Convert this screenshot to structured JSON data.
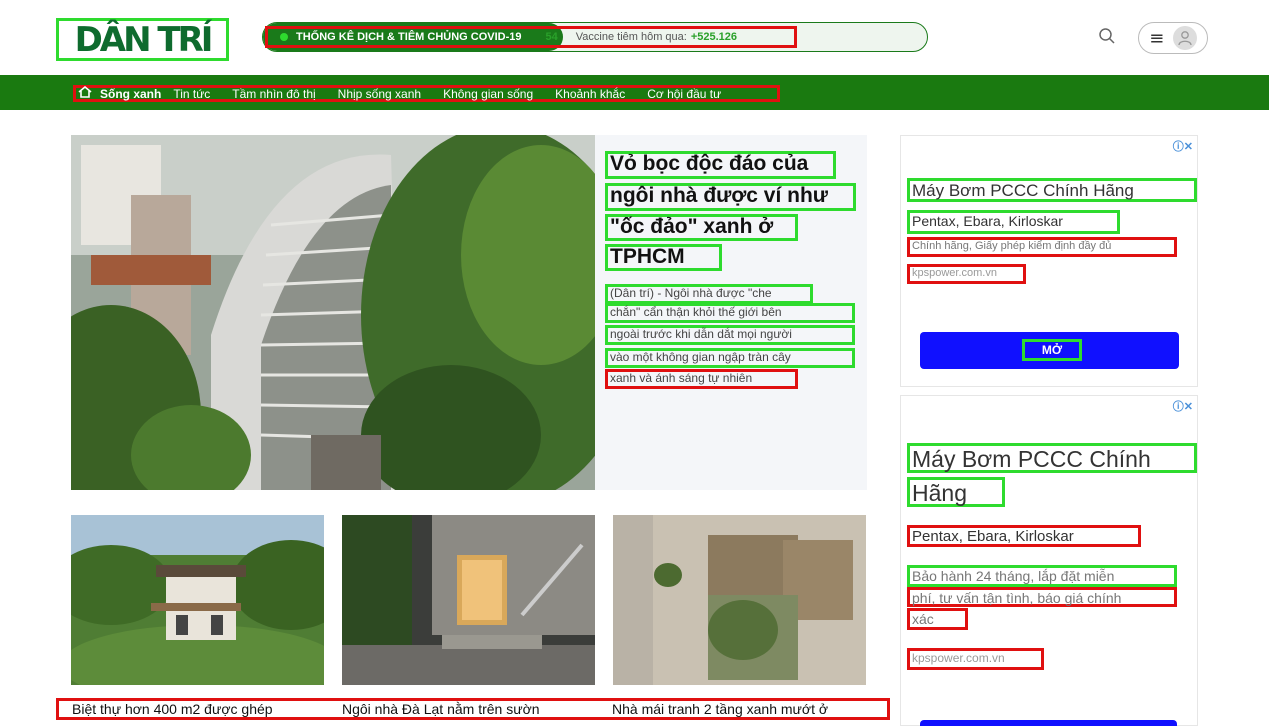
{
  "header": {
    "logo_text": "DÂN TRÍ",
    "covid_title": "THỐNG KÊ DỊCH & TIÊM CHỦNG COVID-19",
    "covid_count": "54",
    "vaccine_label": "Vaccine tiêm hôm qua:",
    "vaccine_count": "+525.126"
  },
  "nav": {
    "items": [
      "Sống xanh",
      "Tin tức",
      "Tầm nhìn đô thị",
      "Nhịp sống xanh",
      "Không gian sống",
      "Khoảnh khắc",
      "Cơ hội đầu tư"
    ]
  },
  "featured": {
    "title_lines": [
      "Vỏ bọc độc đáo của",
      "ngôi nhà được ví như",
      "\"ốc đảo\" xanh ở",
      "TPHCM"
    ],
    "summary_lines": [
      "(Dân trí) - Ngôi nhà được \"che",
      "chắn\" cẩn thận khỏi thế giới bên",
      "ngoài trước khi dẫn dắt mọi người",
      "vào một không gian ngập tràn cây",
      "xanh và ánh sáng tự nhiên"
    ]
  },
  "ad1": {
    "title": "Máy Bơm PCCC Chính Hãng",
    "subtitle": "Pentax, Ebara, Kirloskar",
    "desc": "Chính hãng, Giấy phép kiểm định đầy đủ",
    "url": "kpspower.com.vn",
    "button": "MỞ"
  },
  "ad2": {
    "title_lines": [
      "Máy Bơm PCCC Chính",
      "Hãng"
    ],
    "subtitle": "Pentax, Ebara, Kirloskar",
    "desc_lines": [
      "Bảo hành 24 tháng, lắp đặt miễn",
      "phí, tư vấn tận tình, báo giá chính",
      "xác"
    ],
    "url": "kpspower.com.vn"
  },
  "articles": [
    {
      "caption": "Biệt thự hơn 400 m2 được ghép"
    },
    {
      "caption": "Ngôi nhà Đà Lạt nằm trên sườn"
    },
    {
      "caption": "Nhà mái tranh 2 tầng xanh mướt ở"
    }
  ],
  "colors": {
    "brand_green": "#1a7a10",
    "ad_button": "#1010ff"
  }
}
